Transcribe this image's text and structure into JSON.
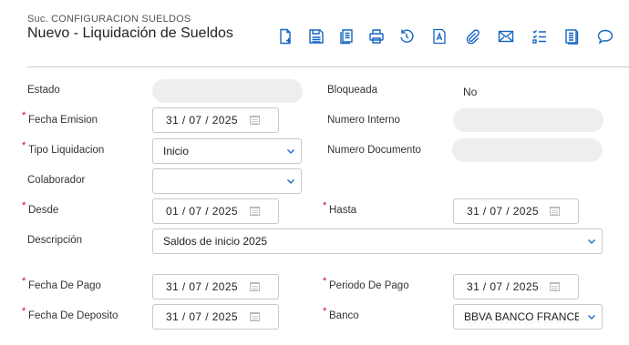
{
  "header": {
    "subtitle": "Suc. CONFIGURACION SUELDOS",
    "title": "Nuevo - Liquidación de Sueldos"
  },
  "toolbar": {
    "icons": [
      "new-document-icon",
      "save-icon",
      "copy-icon",
      "print-icon",
      "undo-icon",
      "text-icon",
      "attachment-icon",
      "email-icon",
      "checklist-icon",
      "notes-icon",
      "comment-icon"
    ]
  },
  "form": {
    "estado": {
      "label": "Estado",
      "value": ""
    },
    "bloqueada": {
      "label": "Bloqueada",
      "value": "No"
    },
    "fecha_emision": {
      "label": "Fecha Emision",
      "value": "31 / 07 / 2025"
    },
    "numero_interno": {
      "label": "Numero Interno",
      "value": ""
    },
    "tipo_liquidacion": {
      "label": "Tipo Liquidacion",
      "value": "Inicio"
    },
    "numero_documento": {
      "label": "Numero Documento",
      "value": ""
    },
    "colaborador": {
      "label": "Colaborador",
      "value": ""
    },
    "desde": {
      "label": "Desde",
      "value": "01 / 07 / 2025"
    },
    "hasta": {
      "label": "Hasta",
      "value": "31 / 07 / 2025"
    },
    "descripcion": {
      "label": "Descripción",
      "value": "Saldos de inicio 2025"
    },
    "fecha_de_pago": {
      "label": "Fecha De Pago",
      "value": "31 / 07 / 2025"
    },
    "periodo_de_pago": {
      "label": "Periodo De Pago",
      "value": "31 / 07 / 2025"
    },
    "fecha_de_deposito": {
      "label": "Fecha De Deposito",
      "value": "31 / 07 / 2025"
    },
    "banco": {
      "label": "Banco",
      "value": "BBVA BANCO FRANCE"
    },
    "required_marker": "*"
  },
  "colors": {
    "icon_blue": "#1565c0",
    "required_red": "#d0021b",
    "field_border": "#c8c8c8",
    "disabled_fill": "#eeeeee"
  }
}
